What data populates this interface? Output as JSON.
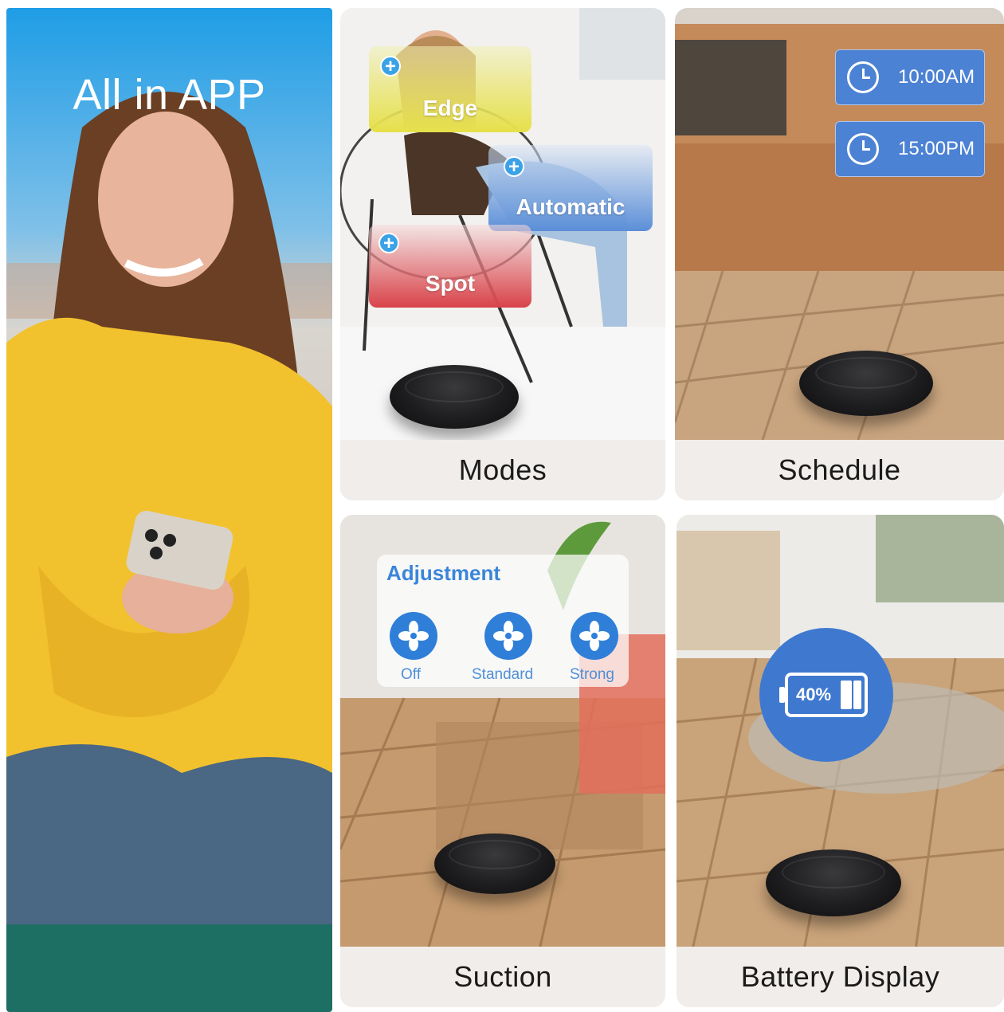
{
  "headline": "All in APP",
  "modes": {
    "caption": "Modes",
    "tiles": [
      {
        "label": "Edge",
        "color": "#e6e04a"
      },
      {
        "label": "Automatic",
        "color": "#5b8fd8"
      },
      {
        "label": "Spot",
        "color": "#d8434a"
      }
    ]
  },
  "schedule": {
    "caption": "Schedule",
    "times": [
      "10:00AM",
      "15:00PM"
    ],
    "icon": "clock-icon"
  },
  "suction": {
    "caption": "Suction",
    "title": "Adjustment",
    "levels": [
      "Off",
      "Standard",
      "Strong"
    ],
    "icon": "fan-icon"
  },
  "battery": {
    "caption": "Battery Display",
    "percent_label": "40%",
    "level": 0.4,
    "icon": "battery-icon"
  },
  "colors": {
    "accent_blue": "#4c82d4",
    "caption_bg": "#f1edea",
    "left_gradient_top": "#1f9de6"
  }
}
